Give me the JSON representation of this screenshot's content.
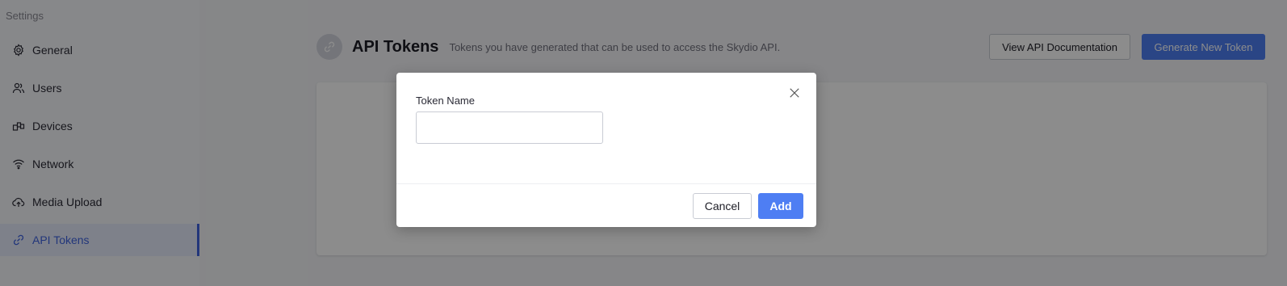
{
  "sidebar": {
    "heading": "Settings",
    "items": [
      {
        "label": "General",
        "icon": "gear-icon"
      },
      {
        "label": "Users",
        "icon": "users-icon"
      },
      {
        "label": "Devices",
        "icon": "devices-icon"
      },
      {
        "label": "Network",
        "icon": "wifi-icon"
      },
      {
        "label": "Media Upload",
        "icon": "cloud-upload-icon"
      },
      {
        "label": "API Tokens",
        "icon": "link-icon",
        "active": true
      }
    ]
  },
  "header": {
    "title": "API Tokens",
    "description": "Tokens you have generated that can be used to access the Skydio API.",
    "icon": "link-icon"
  },
  "actions": {
    "docs_label": "View API Documentation",
    "generate_label": "Generate New Token"
  },
  "modal": {
    "field_label": "Token Name",
    "field_value": "",
    "cancel_label": "Cancel",
    "add_label": "Add",
    "close_icon": "close-icon"
  },
  "colors": {
    "accent": "#4e7ef3",
    "sidebar_active": "#3f63e0",
    "sidebar_bg": "#f6f7fb"
  }
}
